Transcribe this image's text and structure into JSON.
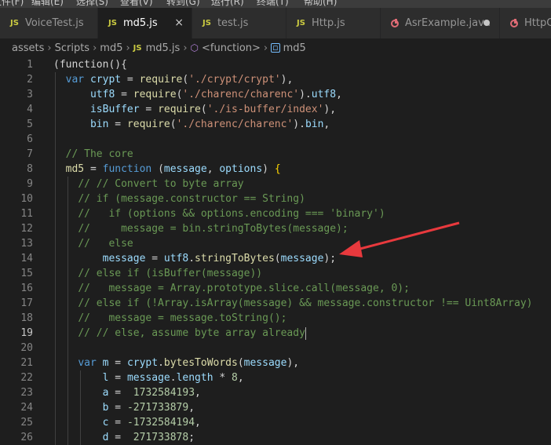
{
  "menu": [
    "文件(F)",
    "编辑(E)",
    "选择(S)",
    "查看(V)",
    "转到(G)",
    "运行(R)",
    "终端(T)",
    "帮助(H)"
  ],
  "tabs": [
    {
      "label": "VoiceTest.js",
      "kind": "js",
      "active": false,
      "state": ""
    },
    {
      "label": "md5.js",
      "kind": "js",
      "active": true,
      "state": "close"
    },
    {
      "label": "test.js",
      "kind": "js",
      "active": false,
      "state": ""
    },
    {
      "label": "Http.js",
      "kind": "js",
      "active": false,
      "state": ""
    },
    {
      "label": "AsrExample.java",
      "kind": "java",
      "active": false,
      "state": "dirty"
    },
    {
      "label": "HttpC",
      "kind": "java",
      "active": false,
      "state": ""
    }
  ],
  "js_badge": "JS",
  "close_glyph": "×",
  "breadcrumb": {
    "items": [
      "assets",
      "Scripts",
      "md5"
    ],
    "file": "md5.js",
    "symbol": "<function>",
    "variable": "md5",
    "separator": "›"
  },
  "editor": {
    "current_line": 19,
    "lines": [
      {
        "n": 1,
        "tokens": [
          [
            "pl",
            "(function(){"
          ]
        ]
      },
      {
        "n": 2,
        "tokens": [
          [
            "pl",
            "  "
          ],
          [
            "kw",
            "var"
          ],
          [
            "pl",
            " "
          ],
          [
            "var",
            "crypt"
          ],
          [
            "pl",
            " = "
          ],
          [
            "fn",
            "require"
          ],
          [
            "pl",
            "("
          ],
          [
            "str",
            "'./crypt/crypt'"
          ],
          [
            "pl",
            "),"
          ]
        ]
      },
      {
        "n": 3,
        "tokens": [
          [
            "pl",
            "      "
          ],
          [
            "var",
            "utf8"
          ],
          [
            "pl",
            " = "
          ],
          [
            "fn",
            "require"
          ],
          [
            "pl",
            "("
          ],
          [
            "str",
            "'./charenc/charenc'"
          ],
          [
            "pl",
            ")."
          ],
          [
            "var",
            "utf8"
          ],
          [
            "pl",
            ","
          ]
        ]
      },
      {
        "n": 4,
        "tokens": [
          [
            "pl",
            "      "
          ],
          [
            "var",
            "isBuffer"
          ],
          [
            "pl",
            " = "
          ],
          [
            "fn",
            "require"
          ],
          [
            "pl",
            "("
          ],
          [
            "str",
            "'./is-buffer/index'"
          ],
          [
            "pl",
            "),"
          ]
        ]
      },
      {
        "n": 5,
        "tokens": [
          [
            "pl",
            "      "
          ],
          [
            "var",
            "bin"
          ],
          [
            "pl",
            " = "
          ],
          [
            "fn",
            "require"
          ],
          [
            "pl",
            "("
          ],
          [
            "str",
            "'./charenc/charenc'"
          ],
          [
            "pl",
            ")."
          ],
          [
            "var",
            "bin"
          ],
          [
            "pl",
            ","
          ]
        ]
      },
      {
        "n": 6,
        "tokens": []
      },
      {
        "n": 7,
        "tokens": [
          [
            "pl",
            "  "
          ],
          [
            "cm",
            "// The core"
          ]
        ]
      },
      {
        "n": 8,
        "tokens": [
          [
            "pl",
            "  "
          ],
          [
            "fn",
            "md5"
          ],
          [
            "pl",
            " = "
          ],
          [
            "kw",
            "function"
          ],
          [
            "pl",
            " ("
          ],
          [
            "var",
            "message"
          ],
          [
            "pl",
            ", "
          ],
          [
            "var",
            "options"
          ],
          [
            "pl",
            ") "
          ],
          [
            "br",
            "{"
          ]
        ]
      },
      {
        "n": 9,
        "tokens": [
          [
            "pl",
            "    "
          ],
          [
            "cm",
            "// // Convert to byte array"
          ]
        ]
      },
      {
        "n": 10,
        "tokens": [
          [
            "pl",
            "    "
          ],
          [
            "cm",
            "// if (message.constructor == String)"
          ]
        ]
      },
      {
        "n": 11,
        "tokens": [
          [
            "pl",
            "    "
          ],
          [
            "cm",
            "//   if (options && options.encoding === 'binary')"
          ]
        ]
      },
      {
        "n": 12,
        "tokens": [
          [
            "pl",
            "    "
          ],
          [
            "cm",
            "//     message = bin.stringToBytes(message);"
          ]
        ]
      },
      {
        "n": 13,
        "tokens": [
          [
            "pl",
            "    "
          ],
          [
            "cm",
            "//   else"
          ]
        ]
      },
      {
        "n": 14,
        "tokens": [
          [
            "pl",
            "        "
          ],
          [
            "var",
            "message"
          ],
          [
            "pl",
            " = "
          ],
          [
            "var",
            "utf8"
          ],
          [
            "pl",
            "."
          ],
          [
            "fn",
            "stringToBytes"
          ],
          [
            "pl",
            "("
          ],
          [
            "var",
            "message"
          ],
          [
            "pl",
            ");"
          ]
        ]
      },
      {
        "n": 15,
        "tokens": [
          [
            "pl",
            "    "
          ],
          [
            "cm",
            "// else if (isBuffer(message))"
          ]
        ]
      },
      {
        "n": 16,
        "tokens": [
          [
            "pl",
            "    "
          ],
          [
            "cm",
            "//   message = Array.prototype.slice.call(message, 0);"
          ]
        ]
      },
      {
        "n": 17,
        "tokens": [
          [
            "pl",
            "    "
          ],
          [
            "cm",
            "// else if (!Array.isArray(message) && message.constructor !== Uint8Array)"
          ]
        ]
      },
      {
        "n": 18,
        "tokens": [
          [
            "pl",
            "    "
          ],
          [
            "cm",
            "//   message = message.toString();"
          ]
        ]
      },
      {
        "n": 19,
        "tokens": [
          [
            "pl",
            "    "
          ],
          [
            "cm",
            "// // else, assume byte array already"
          ]
        ],
        "cursor": true
      },
      {
        "n": 20,
        "tokens": []
      },
      {
        "n": 21,
        "tokens": [
          [
            "pl",
            "    "
          ],
          [
            "kw",
            "var"
          ],
          [
            "pl",
            " "
          ],
          [
            "var",
            "m"
          ],
          [
            "pl",
            " = "
          ],
          [
            "var",
            "crypt"
          ],
          [
            "pl",
            "."
          ],
          [
            "fn",
            "bytesToWords"
          ],
          [
            "pl",
            "("
          ],
          [
            "var",
            "message"
          ],
          [
            "pl",
            "),"
          ]
        ]
      },
      {
        "n": 22,
        "tokens": [
          [
            "pl",
            "        "
          ],
          [
            "var",
            "l"
          ],
          [
            "pl",
            " = "
          ],
          [
            "var",
            "message"
          ],
          [
            "pl",
            "."
          ],
          [
            "var",
            "length"
          ],
          [
            "pl",
            " * "
          ],
          [
            "num",
            "8"
          ],
          [
            "pl",
            ","
          ]
        ]
      },
      {
        "n": 23,
        "tokens": [
          [
            "pl",
            "        "
          ],
          [
            "var",
            "a"
          ],
          [
            "pl",
            " =  "
          ],
          [
            "num",
            "1732584193"
          ],
          [
            "pl",
            ","
          ]
        ]
      },
      {
        "n": 24,
        "tokens": [
          [
            "pl",
            "        "
          ],
          [
            "var",
            "b"
          ],
          [
            "pl",
            " = "
          ],
          [
            "num",
            "-271733879"
          ],
          [
            "pl",
            ","
          ]
        ]
      },
      {
        "n": 25,
        "tokens": [
          [
            "pl",
            "        "
          ],
          [
            "var",
            "c"
          ],
          [
            "pl",
            " = "
          ],
          [
            "num",
            "-1732584194"
          ],
          [
            "pl",
            ","
          ]
        ]
      },
      {
        "n": 26,
        "tokens": [
          [
            "pl",
            "        "
          ],
          [
            "var",
            "d"
          ],
          [
            "pl",
            " =  "
          ],
          [
            "num",
            "271733878"
          ],
          [
            "pl",
            ";"
          ]
        ]
      }
    ]
  },
  "colors": {
    "annotation_arrow": "#e8393d",
    "js_badge": "#cbcb41",
    "java_icon": "#e06c75"
  }
}
